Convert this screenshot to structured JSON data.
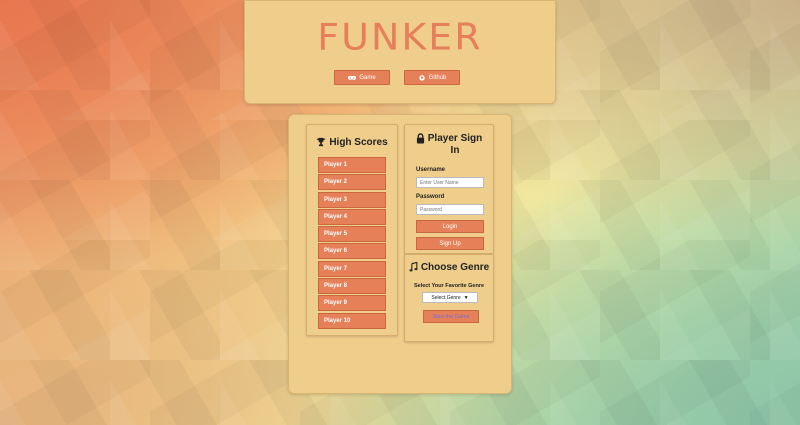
{
  "header": {
    "logo": "FUNKER",
    "game_label": "Game",
    "github_label": "Github",
    "game_icon": "gamepad-icon",
    "github_icon": "github-icon"
  },
  "high_scores": {
    "title": "High Scores",
    "icon": "trophy-icon",
    "players": [
      "Player 1",
      "Player 2",
      "Player 3",
      "Player 4",
      "Player 5",
      "Player 6",
      "Player 7",
      "Player 8",
      "Player 9",
      "Player 10"
    ]
  },
  "sign_in": {
    "title_line1": "Player Sign",
    "title_line2": "In",
    "icon": "lock-icon",
    "username_label": "Username",
    "username_placeholder": "Enter User Name",
    "password_label": "Password",
    "password_placeholder": "Password",
    "login_label": "Login",
    "signup_label": "Sign Up"
  },
  "genre": {
    "title": "Choose Genre",
    "icon": "music-note-icon",
    "subtitle": "Select Your Favorite Genre",
    "select_value": "Select Genre",
    "start_label": "Start the Game"
  },
  "colors": {
    "accent": "#e58058",
    "panel": "#efcd8a",
    "start_text": "#7b6ad1"
  }
}
